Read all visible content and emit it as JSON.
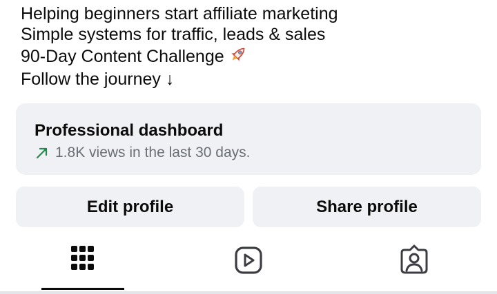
{
  "bio": {
    "lines": [
      "Helping beginners start affiliate marketing",
      "Simple systems for traffic, leads & sales",
      "90-Day Content Challenge",
      "Follow the journey ↓"
    ],
    "emoji_icon": "rocket-icon"
  },
  "dashboard": {
    "title": "Professional dashboard",
    "subtitle": "1.8K views in the last 30 days.",
    "trend_icon": "trend-up-arrow-icon",
    "trend_color": "#1f8a4c"
  },
  "actions": {
    "edit_label": "Edit profile",
    "share_label": "Share profile"
  },
  "tabs": [
    {
      "name": "posts-grid",
      "icon": "grid-icon",
      "active": true
    },
    {
      "name": "reels",
      "icon": "reels-play-icon",
      "active": false
    },
    {
      "name": "tagged",
      "icon": "tagged-person-icon",
      "active": false
    }
  ],
  "colors": {
    "card_bg": "#f0f1f4",
    "text": "#0b0b0b",
    "muted": "#6b6f76"
  }
}
